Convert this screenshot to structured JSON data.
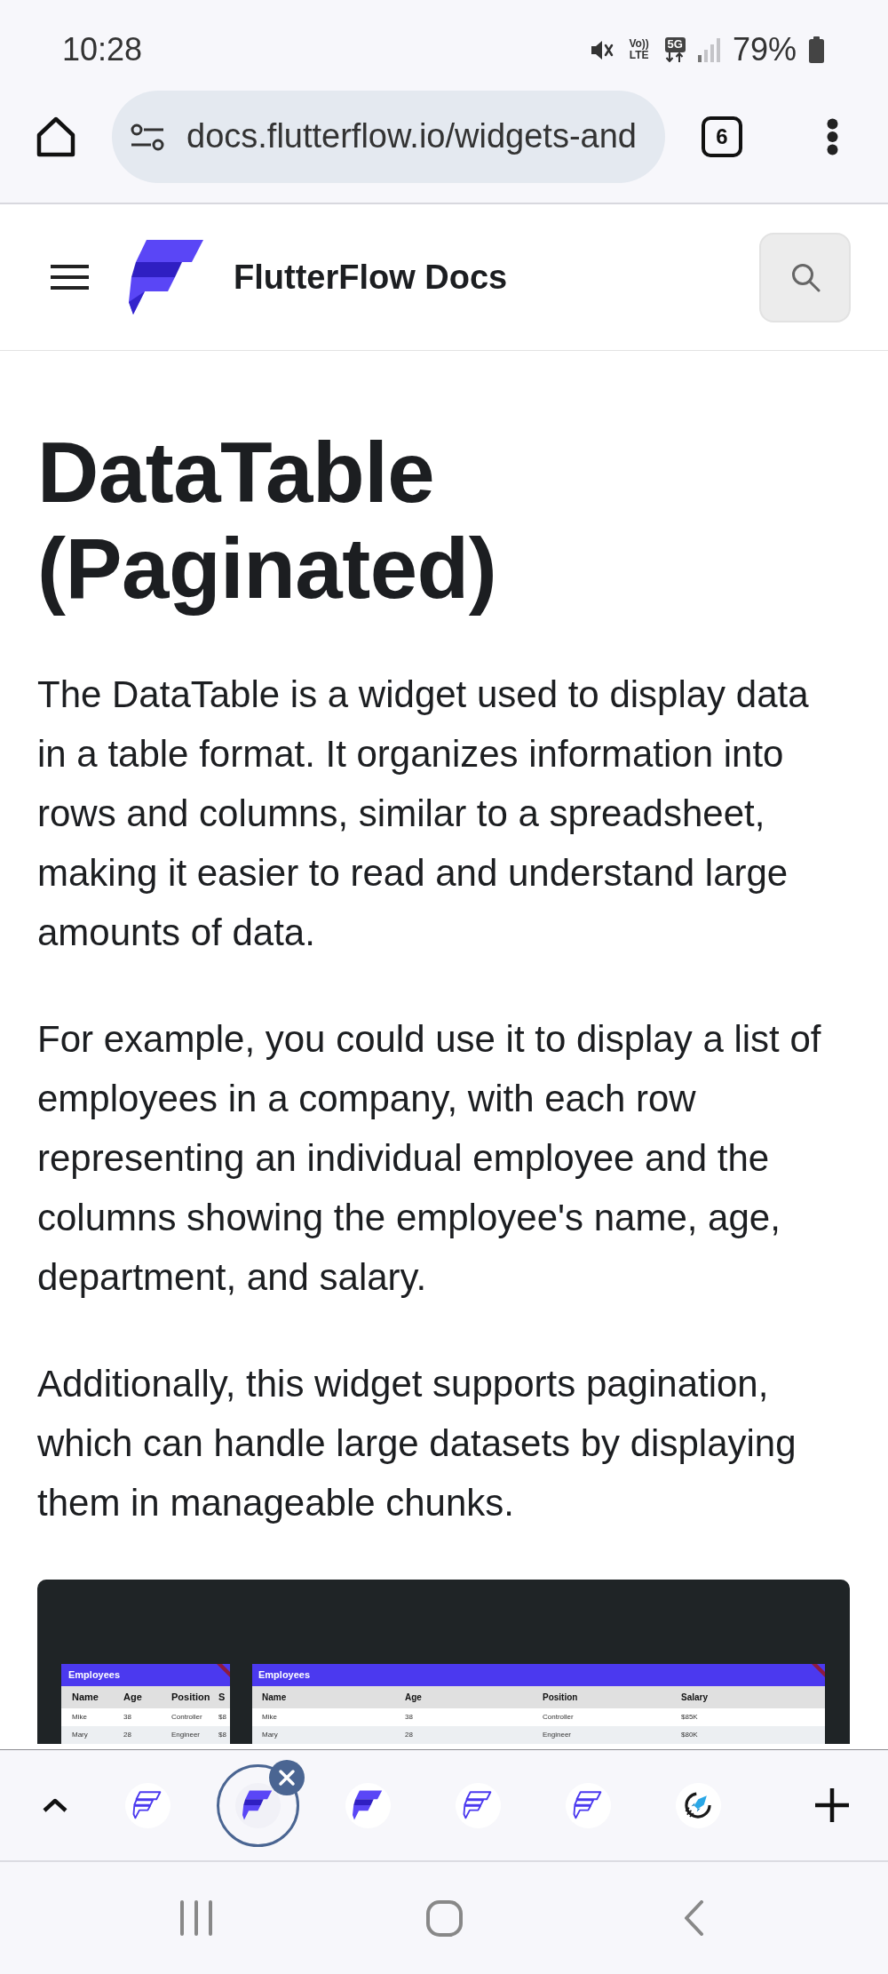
{
  "status_bar": {
    "time": "10:28",
    "volte": "Vo)) LTE",
    "network": "5G",
    "battery": "79%"
  },
  "browser_toolbar": {
    "url": "docs.flutterflow.io/widgets-and",
    "tab_count": "6"
  },
  "site_header": {
    "title": "FlutterFlow Docs"
  },
  "article": {
    "title": "DataTable (Paginated)",
    "paragraphs": [
      "The DataTable is a widget used to display data in a table format. It organizes information into rows and columns, similar to a spreadsheet, making it easier to read and understand large amounts of data.",
      "For example, you could use it to display a list of employees in a company, with each row representing an individual employee and the columns showing the employee's name, age, department, and salary.",
      "Additionally, this widget supports pagination, which can handle large datasets by displaying them in manageable chunks."
    ],
    "figure": {
      "tables": [
        {
          "kind": "narrow",
          "title": "Employees",
          "columns": [
            "Name",
            "Age",
            "Position",
            "S"
          ],
          "rows": [
            [
              "Mike",
              "38",
              "Controller",
              "$8"
            ],
            [
              "Mary",
              "28",
              "Engineer",
              "$8"
            ]
          ]
        },
        {
          "kind": "wide",
          "title": "Employees",
          "columns": [
            "Name",
            "Age",
            "Position",
            "Salary"
          ],
          "rows": [
            [
              "Mike",
              "38",
              "Controller",
              "$85K"
            ],
            [
              "Mary",
              "28",
              "Engineer",
              "$80K"
            ]
          ]
        }
      ]
    }
  },
  "tab_strip": {
    "tabs": [
      {
        "kind": "outline-logo",
        "selected": false
      },
      {
        "kind": "filled-logo",
        "selected": true
      },
      {
        "kind": "filled-logo",
        "selected": false
      },
      {
        "kind": "outline-logo",
        "selected": false
      },
      {
        "kind": "outline-logo",
        "selected": false
      },
      {
        "kind": "rocket",
        "selected": false
      }
    ]
  }
}
